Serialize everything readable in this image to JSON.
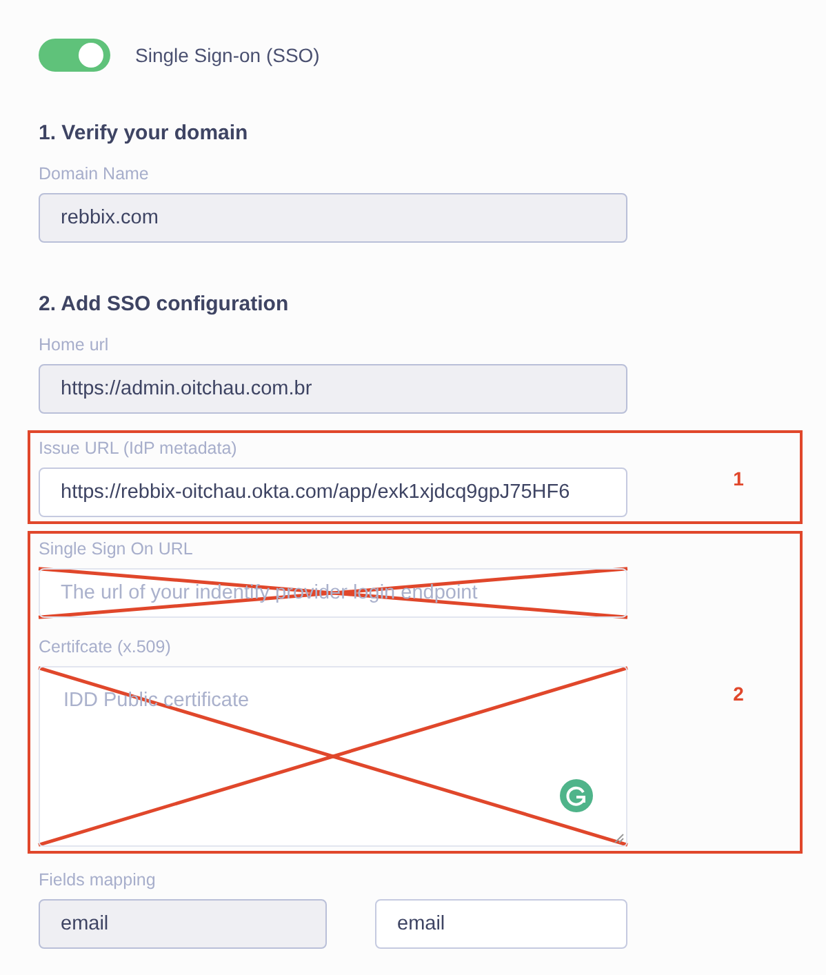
{
  "sso_toggle": {
    "label": "Single Sign-on (SSO)",
    "on": true
  },
  "sections": [
    {
      "heading": "1. Verify your domain",
      "fields": [
        {
          "label": "Domain Name",
          "value": "rebbix.com",
          "disabled": true,
          "kind": "input"
        }
      ]
    },
    {
      "heading": "2. Add SSO configuration",
      "fields": [
        {
          "label": "Home url",
          "value": "https://admin.oitchau.com.br",
          "disabled": true,
          "kind": "input"
        }
      ],
      "annotations": [
        {
          "number": "1",
          "crossed_out": false,
          "fields": [
            {
              "label": "Issue URL (IdP metadata)",
              "value": "https://rebbix-oitchau.okta.com/app/exk1xjdcq9gpJ75HF6",
              "disabled": false,
              "kind": "input"
            }
          ]
        },
        {
          "number": "2",
          "crossed_out": true,
          "fields": [
            {
              "label": "Single Sign On URL",
              "placeholder": "The url of your indentify provider login endpoint",
              "disabled": false,
              "kind": "input"
            },
            {
              "label": "Certifcate (x.509)",
              "placeholder": "IDD Public certificate",
              "disabled": false,
              "kind": "textarea"
            }
          ]
        }
      ]
    }
  ],
  "fields_mapping": {
    "label": "Fields mapping",
    "fields": [
      {
        "value": "email",
        "disabled": true
      },
      {
        "value": "email",
        "disabled": false
      }
    ]
  }
}
